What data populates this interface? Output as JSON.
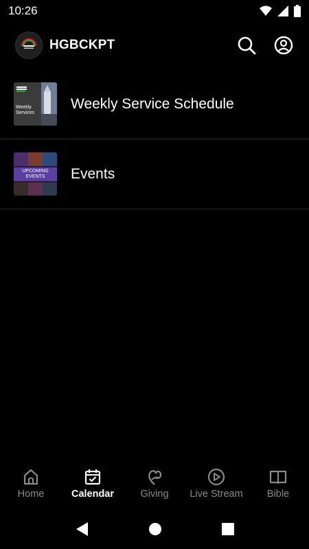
{
  "status": {
    "time": "10:26"
  },
  "header": {
    "title": "HGBCKPT"
  },
  "list": [
    {
      "label": "Weekly Service Schedule",
      "thumb_text": "Weekly Services"
    },
    {
      "label": "Events",
      "thumb_text": "UPCOMING EVENTS"
    }
  ],
  "nav": [
    {
      "label": "Home",
      "icon": "home-icon",
      "active": false
    },
    {
      "label": "Calendar",
      "icon": "calendar-icon",
      "active": true
    },
    {
      "label": "Giving",
      "icon": "giving-icon",
      "active": false
    },
    {
      "label": "Live Stream",
      "icon": "play-circle-icon",
      "active": false
    },
    {
      "label": "Bible",
      "icon": "book-icon",
      "active": false
    }
  ],
  "colors": {
    "background": "#000000",
    "inactive": "#8a8a8a",
    "active": "#ffffff",
    "divider": "#2b2b2b"
  }
}
